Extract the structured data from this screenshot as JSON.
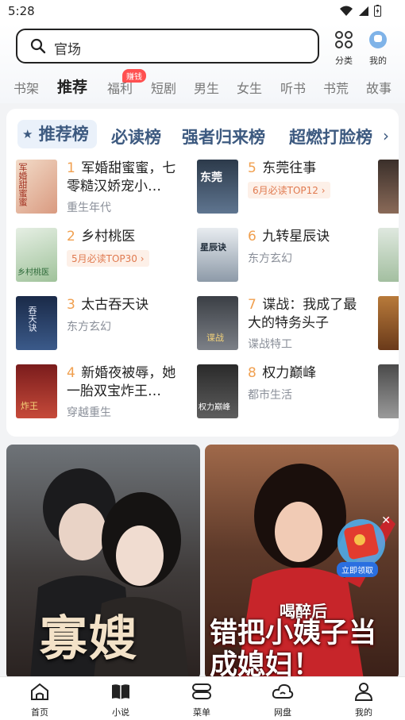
{
  "status": {
    "time": "5:28"
  },
  "search": {
    "text": "官场"
  },
  "top_buttons": {
    "category": "分类",
    "mine": "我的"
  },
  "tabs": [
    {
      "label": "书架"
    },
    {
      "label": "推荐"
    },
    {
      "label": "福利"
    },
    {
      "label": "短剧"
    },
    {
      "label": "男生"
    },
    {
      "label": "女生"
    },
    {
      "label": "听书"
    },
    {
      "label": "书荒"
    },
    {
      "label": "故事"
    }
  ],
  "tab_badge": "赚钱",
  "rank_tabs": [
    "推荐榜",
    "必读榜",
    "强者归来榜",
    "超燃打脸榜"
  ],
  "rank_next": "›",
  "books": [
    {
      "num": "1",
      "title": "军婚甜蜜蜜，七零糙汉娇宠小…",
      "category": "重生年代",
      "tag": ""
    },
    {
      "num": "2",
      "title": "乡村桃医",
      "category": "",
      "tag": "5月必读TOP30 ›"
    },
    {
      "num": "3",
      "title": "太古吞天诀",
      "category": "东方玄幻",
      "tag": ""
    },
    {
      "num": "4",
      "title": "新婚夜被辱，她一胎双宝炸王…",
      "category": "穿越重生",
      "tag": ""
    },
    {
      "num": "5",
      "title": "东莞往事",
      "category": "",
      "tag": "6月必读TOP12 ›"
    },
    {
      "num": "6",
      "title": "九转星辰诀",
      "category": "东方玄幻",
      "tag": ""
    },
    {
      "num": "7",
      "title": "谍战：我成了最大的特务头子",
      "category": "谍战特工",
      "tag": ""
    },
    {
      "num": "8",
      "title": "权力巅峰",
      "category": "都市生活",
      "tag": ""
    }
  ],
  "covers": [
    {
      "text": "军婚甜蜜蜜"
    },
    {
      "text": "乡村桃医"
    },
    {
      "text": "吞天诀"
    },
    {
      "text": "炸王"
    },
    {
      "text": "东莞"
    },
    {
      "text": "星辰诀"
    },
    {
      "text": "谍战"
    },
    {
      "text": "权力巅峰"
    }
  ],
  "banners": [
    {
      "title": "寡嫂"
    },
    {
      "subtitle": "喝醉后",
      "title": "错把小姨子当成媳妇！"
    }
  ],
  "float_button": {
    "label": "立即领取"
  },
  "bottom_nav": [
    {
      "label": "首页"
    },
    {
      "label": "小说"
    },
    {
      "label": "菜单"
    },
    {
      "label": "网盘"
    },
    {
      "label": "我的"
    }
  ],
  "colors": {
    "accent": "#3d5a80",
    "rank_number": "#f0a050",
    "badge": "#ff5050"
  }
}
